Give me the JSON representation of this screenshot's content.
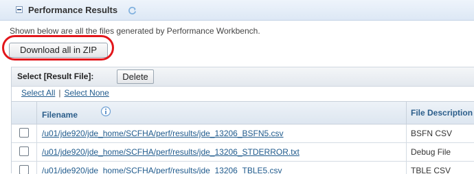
{
  "section": {
    "title": "Performance Results",
    "description": "Shown below are all the files generated by Performance Workbench."
  },
  "actions": {
    "download_all_label": "Download all in ZIP"
  },
  "results_table": {
    "toolbar_label": "Select [Result File]:",
    "delete_label": "Delete",
    "select_all_label": "Select All",
    "separator": "|",
    "select_none_label": "Select None",
    "columns": {
      "filename": "Filename",
      "description": "File Description"
    },
    "rows": [
      {
        "filename": "/u01/jde920/jde_home/SCFHA/perf/results/jde_13206_BSFN5.csv",
        "description": "BSFN CSV"
      },
      {
        "filename": "/u01/jde920/jde_home/SCFHA/perf/results/jde_13206_STDERROR.txt",
        "description": "Debug File"
      },
      {
        "filename": "/u01/jde920/jde_home/SCFHA/perf/results/jde_13206_TBLE5.csv",
        "description": "TBLE CSV"
      }
    ]
  },
  "colors": {
    "highlight_ring": "#e2161b",
    "link": "#1f5a8c",
    "header_text": "#2b5d8a"
  },
  "icons": {
    "collapse": "minus-box-icon",
    "refresh": "refresh-icon",
    "info": "info-icon"
  }
}
